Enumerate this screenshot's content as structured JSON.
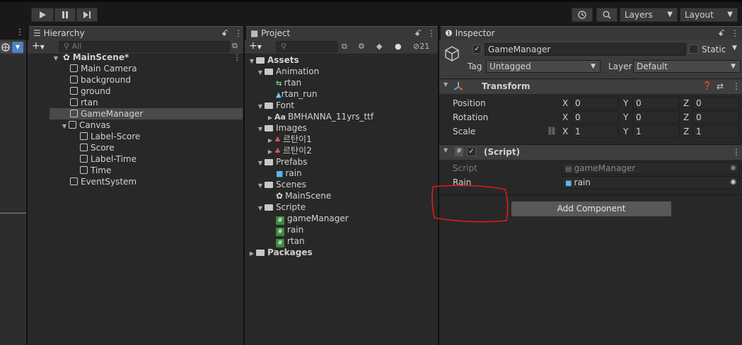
{
  "toolbar": {
    "play_icon": "play-icon",
    "pause_icon": "pause-icon",
    "step_icon": "step-icon",
    "layers_label": "Layers",
    "layout_label": "Layout"
  },
  "scene_strip": {
    "menu_dots": "⋮"
  },
  "hierarchy": {
    "tab_label": "Hierarchy",
    "search_placeholder": "All",
    "scene_name": "MainScene*",
    "items": [
      {
        "label": "Main Camera"
      },
      {
        "label": "background"
      },
      {
        "label": "ground"
      },
      {
        "label": "rtan"
      },
      {
        "label": "GameManager"
      },
      {
        "label": "Canvas"
      },
      {
        "label": "Label-Score"
      },
      {
        "label": "Score"
      },
      {
        "label": "Label-Time"
      },
      {
        "label": "Time"
      },
      {
        "label": "EventSystem"
      }
    ]
  },
  "project": {
    "tab_label": "Project",
    "hidden_count": "21",
    "tree": [
      {
        "label": "Assets"
      },
      {
        "label": "Animation"
      },
      {
        "label": "rtan"
      },
      {
        "label": "rtan_run"
      },
      {
        "label": "Font"
      },
      {
        "label": "BMHANNA_11yrs_ttf",
        "prefix": "Aa"
      },
      {
        "label": "Images"
      },
      {
        "label": "르탄이1"
      },
      {
        "label": "르탄이2"
      },
      {
        "label": "Prefabs"
      },
      {
        "label": "rain"
      },
      {
        "label": "Scenes"
      },
      {
        "label": "MainScene"
      },
      {
        "label": "Scripte"
      },
      {
        "label": "gameManager"
      },
      {
        "label": "rain"
      },
      {
        "label": "rtan"
      },
      {
        "label": "Packages"
      }
    ]
  },
  "inspector": {
    "tab_label": "Inspector",
    "object_name": "GameManager",
    "static_label": "Static",
    "tag_label": "Tag",
    "tag_value": "Untagged",
    "layer_label": "Layer",
    "layer_value": "Default",
    "transform": {
      "title": "Transform",
      "rows": [
        {
          "label": "Position",
          "x": "0",
          "y": "0",
          "z": "0"
        },
        {
          "label": "Rotation",
          "x": "0",
          "y": "0",
          "z": "0"
        },
        {
          "label": "Scale",
          "x": "1",
          "y": "1",
          "z": "1"
        }
      ],
      "axis_x": "X",
      "axis_y": "Y",
      "axis_z": "Z"
    },
    "script_component": {
      "title": "(Script)",
      "script_label": "Script",
      "script_value": "gameManager",
      "rain_label": "Rain",
      "rain_value": "rain"
    },
    "add_component_label": "Add Component"
  },
  "annotation": {
    "color": "#e01b1b"
  }
}
